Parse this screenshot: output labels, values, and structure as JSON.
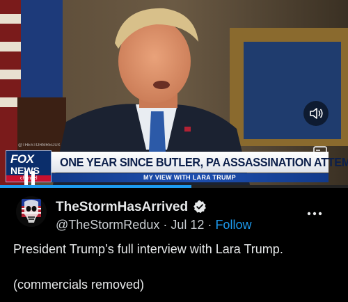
{
  "video": {
    "watermark": "@THESTORMREDUX",
    "network_logo": {
      "top": "FOX",
      "bottom": "NEWS",
      "strip": "channel"
    },
    "headline": "ONE YEAR SINCE BUTLER, PA ASSASSINATION ATTEMPT",
    "subheadline": "MY VIEW WITH LARA TRUMP",
    "progress_fraction": 0.55,
    "controls": {
      "pause": "pause-icon",
      "volume": "volume-icon",
      "captions": "captions-icon"
    }
  },
  "post": {
    "author_name": "TheStormHasArrived",
    "handle": "@TheStormRedux",
    "separator": "·",
    "date": "Jul 12",
    "follow_label": "Follow",
    "text": "President Trump’s full interview with Lara Trump.",
    "text_second": "(commercials removed)"
  },
  "colors": {
    "accent": "#1d9bf0",
    "background": "#000000",
    "text": "#e7e9ea",
    "fox_blue": "#0b2e6b",
    "fox_red": "#c8102e"
  }
}
